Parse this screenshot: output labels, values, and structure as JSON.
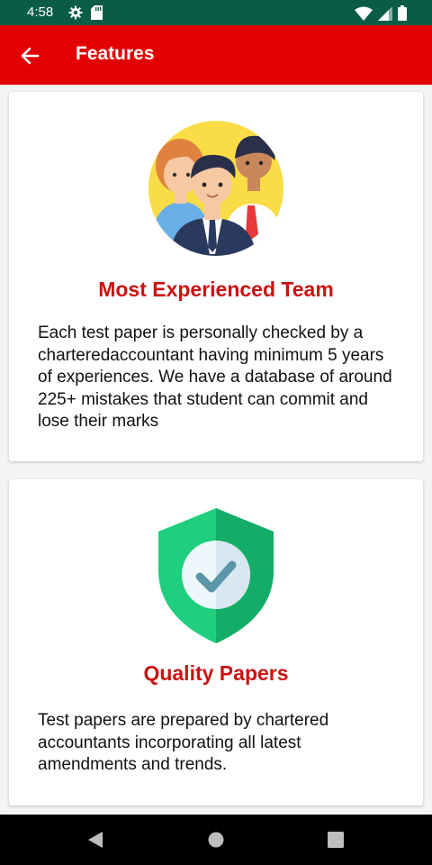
{
  "status_bar": {
    "time": "4:58",
    "icons": [
      "gear-icon",
      "sd-card-icon",
      "wifi-icon",
      "signal-icon",
      "battery-icon"
    ]
  },
  "app_bar": {
    "title": "Features",
    "back_icon": "arrow-left-icon",
    "background": "#e20000"
  },
  "features": [
    {
      "title": "Most Experienced Team",
      "description": "Each test paper is personally checked by a charteredaccountant having minimum 5 years of experiences. We have a database of around 225+ mistakes that student can commit and lose their marks",
      "illustration": "team-illustration"
    },
    {
      "title": "Quality Papers",
      "description": "Test papers are prepared by chartered accountants incorporating all latest amendments and trends.",
      "illustration": "shield-check-icon"
    }
  ],
  "nav_bar": {
    "icons": [
      "back-triangle-icon",
      "home-circle-icon",
      "recents-square-icon"
    ]
  },
  "colors": {
    "accent": "#cc1212",
    "status_bar": "#0b5c47",
    "shield": "#1fcf7e"
  }
}
